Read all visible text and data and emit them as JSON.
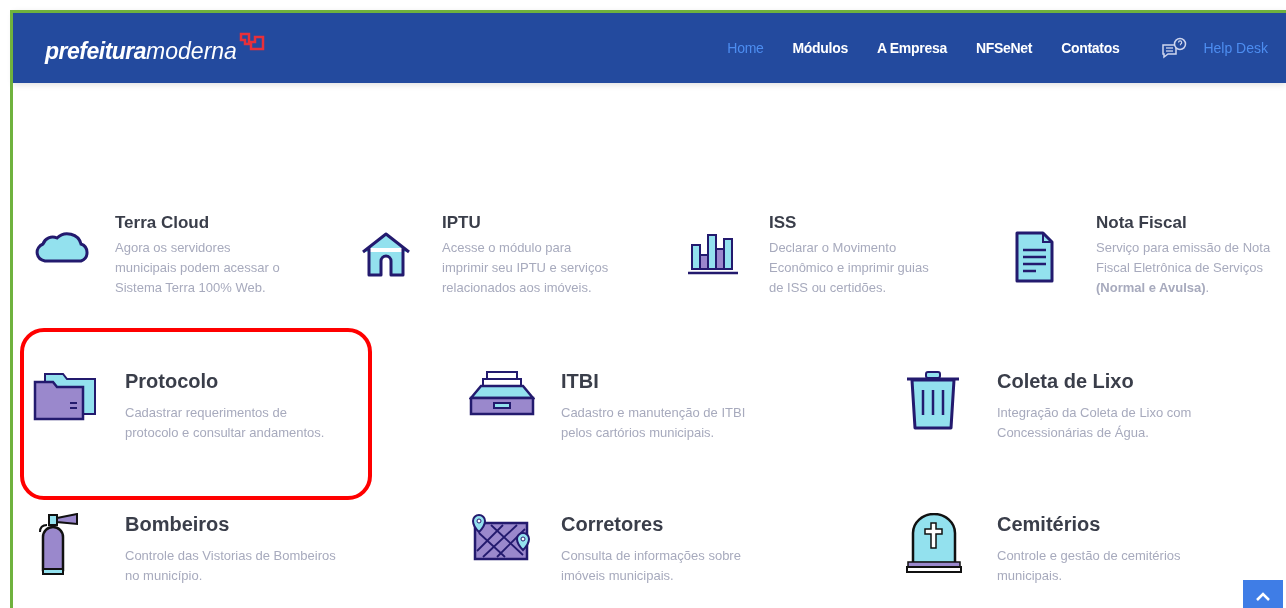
{
  "header": {
    "logo": {
      "bold": "prefeitura",
      "light": "moderna"
    },
    "nav": [
      {
        "label": "Home",
        "selected": true
      },
      {
        "label": "Módulos",
        "selected": false
      },
      {
        "label": "A Empresa",
        "selected": false
      },
      {
        "label": "NFSeNet",
        "selected": false
      },
      {
        "label": "Contatos",
        "selected": false
      }
    ],
    "help_desk": "Help Desk"
  },
  "rows": [
    {
      "kind": "small",
      "items": [
        {
          "title": "Terra Cloud",
          "lines": [
            "Agora os servidores",
            "municipais podem acessar o",
            "Sistema Terra 100% Web."
          ],
          "highlighted": false
        },
        {
          "title": "IPTU",
          "lines": [
            "Acesse o módulo para",
            "imprimir seu IPTU e serviços",
            "relacionados aos imóveis."
          ],
          "highlighted": false
        },
        {
          "title": "ISS",
          "lines": [
            "Declarar o Movimento",
            "Econômico e imprimir guias",
            "de ISS ou certidões."
          ],
          "highlighted": false
        },
        {
          "title": "Nota Fiscal",
          "lines": [
            "Serviço para emissão de Nota",
            "Fiscal Eletrônica de Serviços",
            "**(Normal e Avulsa)**."
          ],
          "highlighted": false
        }
      ]
    },
    {
      "kind": "large",
      "items": [
        {
          "title": "Protocolo",
          "lines": [
            "Cadastrar requerimentos de",
            "protocolo e consultar andamentos."
          ],
          "highlighted": true
        },
        {
          "title": "ITBI",
          "lines": [
            "Cadastro e manutenção de ITBI",
            "pelos cartórios municipais."
          ],
          "highlighted": false
        },
        {
          "title": "Coleta de Lixo",
          "lines": [
            "Integração da Coleta de Lixo com",
            "Concessionárias de Água."
          ],
          "highlighted": false
        }
      ]
    },
    {
      "kind": "large",
      "items": [
        {
          "title": "Bombeiros",
          "lines": [
            "Controle das Vistorias de Bombeiros",
            "no município."
          ],
          "highlighted": false
        },
        {
          "title": "Corretores",
          "lines": [
            "Consulta de informações sobre",
            "imóveis municipais."
          ],
          "highlighted": false
        },
        {
          "title": "Cemitérios",
          "lines": [
            "Controle e gestão de cemitérios",
            "municipais."
          ],
          "highlighted": false
        }
      ]
    }
  ]
}
